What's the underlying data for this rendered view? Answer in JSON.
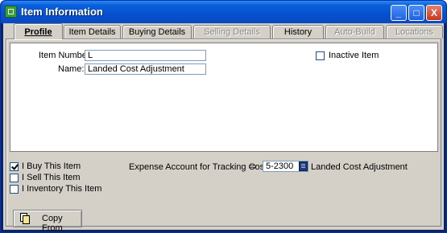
{
  "window": {
    "title": "Item Information"
  },
  "title_buttons": {
    "minimize": "_",
    "maximize": "□",
    "close": "X"
  },
  "tabs": [
    {
      "label": "Profile",
      "state": "active"
    },
    {
      "label": "Item Details",
      "state": "enabled"
    },
    {
      "label": "Buying Details",
      "state": "enabled"
    },
    {
      "label": "Selling Details",
      "state": "disabled"
    },
    {
      "label": "History",
      "state": "enabled"
    },
    {
      "label": "Auto-Build",
      "state": "disabled"
    },
    {
      "label": "Locations",
      "state": "disabled"
    }
  ],
  "profile": {
    "item_number_label": "Item Number:",
    "item_number_value": "L",
    "name_label": "Name:",
    "name_value": "Landed Cost Adjustment",
    "inactive_label": "Inactive Item",
    "inactive_checked": false
  },
  "options": {
    "buy_label": "I Buy This Item",
    "buy_checked": true,
    "sell_label": "I Sell This Item",
    "sell_checked": false,
    "inventory_label": "I Inventory This Item",
    "inventory_checked": false
  },
  "expense": {
    "label": "Expense Account for Tracking Costs",
    "arrow_icon": "arrow-right-icon",
    "account_value": "5-2300",
    "account_name": "Landed Cost Adjustment"
  },
  "copy_from": {
    "label": "Copy From",
    "icon": "copy-document-icon"
  }
}
